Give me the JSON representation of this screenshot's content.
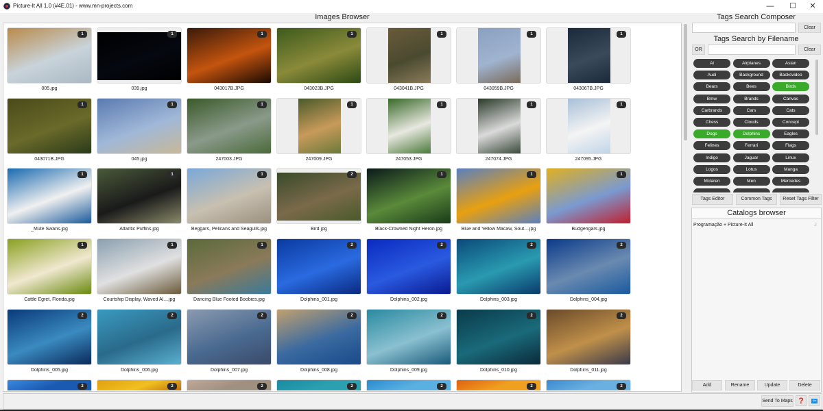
{
  "window": {
    "title": "Picture-It All 1.0 (#4E.01) - www.mn-projects.com",
    "minimize": "—",
    "maximize": "☐",
    "close": "✕"
  },
  "images_browser": {
    "title": "Images Browser",
    "items": [
      {
        "name": "005.jpg",
        "count": "1",
        "colors": [
          "#b98a4a",
          "#c9d3da",
          "#a9b9c4"
        ],
        "fit": "full"
      },
      {
        "name": "039.jpg",
        "count": "1",
        "colors": [
          "#000000",
          "#050810",
          "#000000"
        ],
        "fit": "wide"
      },
      {
        "name": "043017B.JPG",
        "count": "1",
        "colors": [
          "#3a1a0a",
          "#c4540e",
          "#1a0a04"
        ],
        "fit": "full"
      },
      {
        "name": "043023B.JPG",
        "count": "1",
        "colors": [
          "#3d5a1c",
          "#8a8a3a",
          "#2d4a14"
        ],
        "fit": "full"
      },
      {
        "name": "043041B.JPG",
        "count": "1",
        "colors": [
          "#6a5a3a",
          "#4a4a30",
          "#8a7a5a"
        ],
        "fit": "portrait"
      },
      {
        "name": "043059B.JPG",
        "count": "1",
        "colors": [
          "#8aa0c0",
          "#a0b4d0",
          "#7a6a5a"
        ],
        "fit": "portrait"
      },
      {
        "name": "043067B.JPG",
        "count": "1",
        "colors": [
          "#1a2a3a",
          "#3a4a5a",
          "#1a2a3a"
        ],
        "fit": "portrait"
      },
      {
        "name": "043071B.JPG",
        "count": "1",
        "colors": [
          "#4a4a1a",
          "#6a6a2a",
          "#2a3a1a"
        ],
        "fit": "full"
      },
      {
        "name": "045.jpg",
        "count": "1",
        "colors": [
          "#5a7ab0",
          "#a0b8d8",
          "#c8b898"
        ],
        "fit": "full"
      },
      {
        "name": "247003.JPG",
        "count": "1",
        "colors": [
          "#3a5a2a",
          "#8a9a8a",
          "#4a6a3a"
        ],
        "fit": "full"
      },
      {
        "name": "247009.JPG",
        "count": "1",
        "colors": [
          "#4a5a2a",
          "#c89a5a",
          "#6a7a3a"
        ],
        "fit": "portrait"
      },
      {
        "name": "247053.JPG",
        "count": "1",
        "colors": [
          "#3a6a2a",
          "#e8e8e0",
          "#4a7a3a"
        ],
        "fit": "portrait"
      },
      {
        "name": "247074.JPG",
        "count": "1",
        "colors": [
          "#2a3a2a",
          "#dadada",
          "#3a4a3a"
        ],
        "fit": "portrait"
      },
      {
        "name": "247095.JPG",
        "count": "1",
        "colors": [
          "#a8c0d8",
          "#f4f4f4",
          "#c0d4e8"
        ],
        "fit": "portrait"
      },
      {
        "name": "_Mute Swans.jpg",
        "count": "1",
        "colors": [
          "#1a6ab0",
          "#f0f0f0",
          "#1a5a9a"
        ],
        "fit": "full"
      },
      {
        "name": "Atlantic Puffins.jpg",
        "count": "1",
        "colors": [
          "#4a5a3a",
          "#1a1a1a",
          "#8a8a6a"
        ],
        "fit": "full"
      },
      {
        "name": "Beggars, Pelicans and Seagulls.jpg",
        "count": "1",
        "colors": [
          "#7aa8d8",
          "#c8c0b0",
          "#9a9080"
        ],
        "fit": "full"
      },
      {
        "name": "Bird.jpg",
        "count": "2",
        "colors": [
          "#3a4a2a",
          "#7a6a4a",
          "#4a5a2a"
        ],
        "fit": "wide"
      },
      {
        "name": "Black-Crowned Night Heron.jpg",
        "count": "1",
        "colors": [
          "#0a1a1a",
          "#5a8a3a",
          "#1a3a1a"
        ],
        "fit": "full"
      },
      {
        "name": "Blue and Yellow Macaw, Sout....jpg",
        "count": "1",
        "colors": [
          "#5a80c0",
          "#e8a010",
          "#5a80c0"
        ],
        "fit": "full"
      },
      {
        "name": "Budgerigars.jpg",
        "count": "1",
        "colors": [
          "#e0b020",
          "#7a9ad0",
          "#c02030"
        ],
        "fit": "full"
      },
      {
        "name": "Cattle Egret, Florida.jpg",
        "count": "1",
        "colors": [
          "#8aa020",
          "#f0e8d0",
          "#6a8a10"
        ],
        "fit": "full"
      },
      {
        "name": "Courtship Display, Waved Al....jpg",
        "count": "1",
        "colors": [
          "#8aa0b0",
          "#e0e0e0",
          "#6a5a3a"
        ],
        "fit": "full"
      },
      {
        "name": "Dancing Blue Footed Boobies.jpg",
        "count": "1",
        "colors": [
          "#5a6a3a",
          "#8a7a5a",
          "#3a7a9a"
        ],
        "fit": "full"
      },
      {
        "name": "Dolphins_001.jpg",
        "count": "2",
        "colors": [
          "#0a3aa0",
          "#2a6ae0",
          "#0a2a80"
        ],
        "fit": "full"
      },
      {
        "name": "Dolphins_002.jpg",
        "count": "2",
        "colors": [
          "#0a2ac0",
          "#2a5ae0",
          "#0a1a90"
        ],
        "fit": "full"
      },
      {
        "name": "Dolphins_003.jpg",
        "count": "2",
        "colors": [
          "#0a4a7a",
          "#2a9ab0",
          "#0a3a6a"
        ],
        "fit": "full"
      },
      {
        "name": "Dolphins_004.jpg",
        "count": "2",
        "colors": [
          "#0a3a8a",
          "#6a8ab0",
          "#1a5aa0"
        ],
        "fit": "full"
      },
      {
        "name": "Dolphins_005.jpg",
        "count": "2",
        "colors": [
          "#0a3a7a",
          "#3a8ac0",
          "#0a2a5a"
        ],
        "fit": "full"
      },
      {
        "name": "Dolphins_006.jpg",
        "count": "2",
        "colors": [
          "#3a9ac0",
          "#2a6a8a",
          "#5ab0d0"
        ],
        "fit": "full"
      },
      {
        "name": "Dolphins_007.jpg",
        "count": "2",
        "colors": [
          "#8a9ab0",
          "#4a6a90",
          "#3a4a6a"
        ],
        "fit": "full"
      },
      {
        "name": "Dolphins_008.jpg",
        "count": "2",
        "colors": [
          "#c0a070",
          "#3a6aa0",
          "#1a4a8a"
        ],
        "fit": "full"
      },
      {
        "name": "Dolphins_009.jpg",
        "count": "2",
        "colors": [
          "#2a8aa0",
          "#8ac0d0",
          "#1a5a7a"
        ],
        "fit": "full"
      },
      {
        "name": "Dolphins_010.jpg",
        "count": "2",
        "colors": [
          "#0a3a4a",
          "#1a6a7a",
          "#0a2a3a"
        ],
        "fit": "full"
      },
      {
        "name": "Dolphins_011.jpg",
        "count": "2",
        "colors": [
          "#6a4a2a",
          "#c0904a",
          "#3a3a4a"
        ],
        "fit": "full"
      },
      {
        "name": "",
        "count": "2",
        "colors": [
          "#3a8ae0",
          "#1a5ab0",
          "#1a5ab0"
        ],
        "fit": "full"
      },
      {
        "name": "",
        "count": "2",
        "colors": [
          "#e0a010",
          "#f0c020",
          "#c07010"
        ],
        "fit": "full"
      },
      {
        "name": "",
        "count": "2",
        "colors": [
          "#c0a898",
          "#a09080",
          "#a09080"
        ],
        "fit": "full"
      },
      {
        "name": "",
        "count": "2",
        "colors": [
          "#1a8aa0",
          "#2aa0b0",
          "#2aa0b0"
        ],
        "fit": "full"
      },
      {
        "name": "",
        "count": "2",
        "colors": [
          "#2a8ad0",
          "#5ab0e0",
          "#5ab0e0"
        ],
        "fit": "full"
      },
      {
        "name": "",
        "count": "2",
        "colors": [
          "#e06010",
          "#f0a020",
          "#f0a020"
        ],
        "fit": "full"
      },
      {
        "name": "",
        "count": "2",
        "colors": [
          "#3a8ad0",
          "#6ab0e0",
          "#6ab0e0"
        ],
        "fit": "full"
      }
    ]
  },
  "tags_panel": {
    "composer_title": "Tags Search Composer",
    "composer_value": "",
    "clear_label": "Clear",
    "filename_title": "Tags Search by Filename",
    "or_label": "OR",
    "filename_value": "",
    "clear2_label": "Clear",
    "tags": [
      {
        "label": "Ai",
        "active": false
      },
      {
        "label": "Airplanes",
        "active": false
      },
      {
        "label": "Asian",
        "active": false
      },
      {
        "label": "Audi",
        "active": false
      },
      {
        "label": "Background",
        "active": false
      },
      {
        "label": "Backsvideo",
        "active": false
      },
      {
        "label": "Bears",
        "active": false
      },
      {
        "label": "Bees",
        "active": false
      },
      {
        "label": "Birds",
        "active": true
      },
      {
        "label": "Bmw",
        "active": false
      },
      {
        "label": "Brands",
        "active": false
      },
      {
        "label": "Canvas",
        "active": false
      },
      {
        "label": "Carbrands",
        "active": false
      },
      {
        "label": "Cars",
        "active": false
      },
      {
        "label": "Cats",
        "active": false
      },
      {
        "label": "Chess",
        "active": false
      },
      {
        "label": "Clouds",
        "active": false
      },
      {
        "label": "Concept",
        "active": false
      },
      {
        "label": "Dogs",
        "active": true
      },
      {
        "label": "Dolphins",
        "active": true
      },
      {
        "label": "Eagles",
        "active": false
      },
      {
        "label": "Felines",
        "active": false
      },
      {
        "label": "Ferrari",
        "active": false
      },
      {
        "label": "Flags",
        "active": false
      },
      {
        "label": "Indigo",
        "active": false
      },
      {
        "label": "Jaguar",
        "active": false
      },
      {
        "label": "Linux",
        "active": false
      },
      {
        "label": "Logos",
        "active": false
      },
      {
        "label": "Lotus",
        "active": false
      },
      {
        "label": "Manga",
        "active": false
      },
      {
        "label": "Mclaren",
        "active": false
      },
      {
        "label": "Men",
        "active": false
      },
      {
        "label": "Mercedes",
        "active": false
      },
      {
        "label": "",
        "active": false
      },
      {
        "label": "",
        "active": false
      },
      {
        "label": "",
        "active": false
      }
    ],
    "tags_editor_label": "Tags Editor",
    "common_tags_label": "Common Tags",
    "reset_label": "Reset Tags Filter",
    "active_color": "#3aaa2a",
    "inactive_color": "#3c3c3c"
  },
  "catalogs": {
    "title": "Catalogs browser",
    "items": [
      {
        "name": "Programação + Picture-It All",
        "count": "2"
      }
    ],
    "add_label": "Add",
    "rename_label": "Rename",
    "update_label": "Update",
    "delete_label": "Delete"
  },
  "bottom": {
    "send_to_maps_label": "Send To Maps",
    "help_label": "?",
    "back_label": "⇦"
  }
}
